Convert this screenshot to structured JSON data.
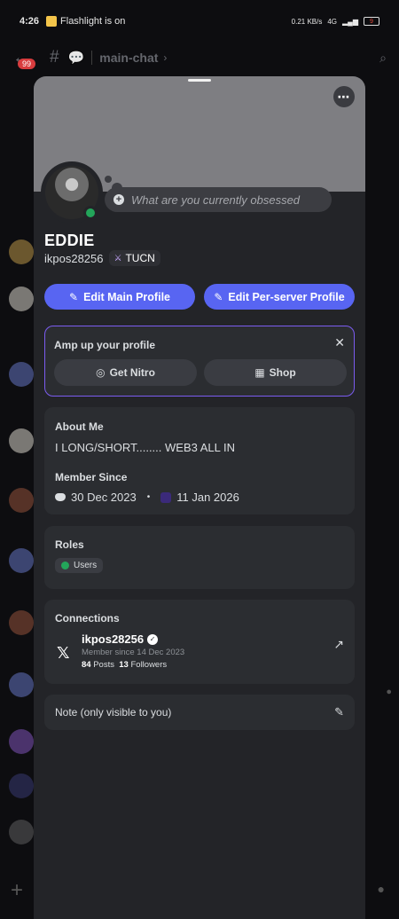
{
  "status_bar": {
    "time": "4:26",
    "notification": "Flashlight is on",
    "net": "0.21 KB/s",
    "network_type": "4G",
    "battery": "9"
  },
  "background": {
    "channel": "main-chat",
    "badge": "99"
  },
  "profile": {
    "status_placeholder": "What are you currently obsessed",
    "display_name": "EDDIE",
    "username": "ikpos28256",
    "server_tag": "TUCN",
    "edit_main": "Edit Main Profile",
    "edit_server": "Edit Per-server Profile"
  },
  "amp": {
    "title": "Amp up your profile",
    "nitro": "Get Nitro",
    "shop": "Shop"
  },
  "about": {
    "heading": "About Me",
    "bio": "I LONG/SHORT........ WEB3 ALL IN",
    "member_heading": "Member Since",
    "discord_since": "30 Dec 2023",
    "server_since": "11 Jan 2026"
  },
  "roles": {
    "heading": "Roles",
    "items": [
      "Users"
    ]
  },
  "connections": {
    "heading": "Connections",
    "name": "ikpos28256",
    "since": "Member since 14 Dec 2023",
    "posts_count": "84",
    "posts_label": "Posts",
    "followers_count": "13",
    "followers_label": "Followers"
  },
  "note": {
    "label": "Note (only visible to you)"
  },
  "colors": {
    "blurple": "#5865f2",
    "online": "#23a55a",
    "nitro_border": "#7b5cf0",
    "card": "#2b2d31",
    "sheet": "#232428"
  }
}
